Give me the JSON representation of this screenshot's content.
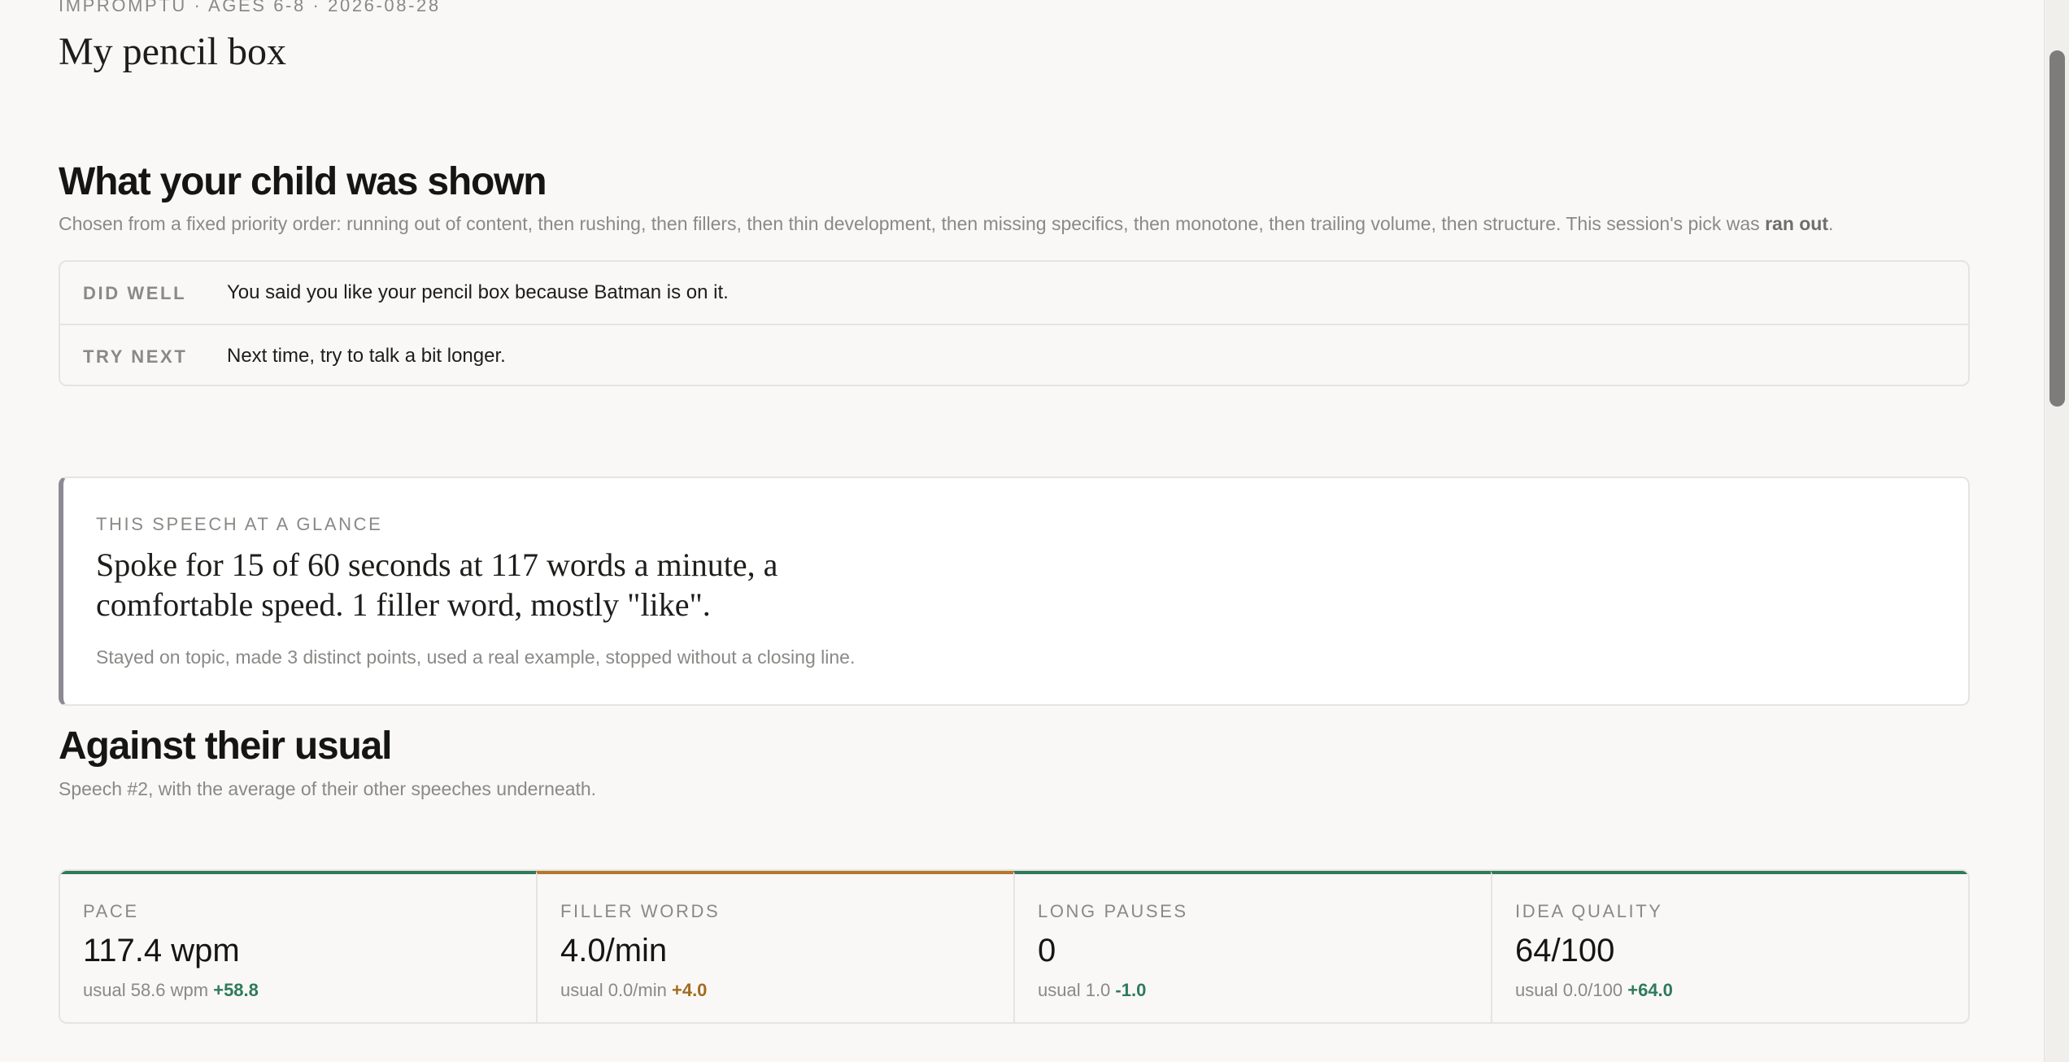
{
  "header": {
    "eyebrow": "IMPROMPTU · AGES 6-8 · 2026-08-28",
    "title": "My pencil box"
  },
  "shown": {
    "heading": "What your child was shown",
    "description": "Chosen from a fixed priority order: running out of content, then rushing, then fillers, then thin development, then missing specifics, then monotone, then trailing volume, then structure. This session's pick was ",
    "pick": "ran out",
    "pick_suffix": ".",
    "rows": [
      {
        "label": "DID WELL",
        "text": "You said you like your pencil box because Batman is on it."
      },
      {
        "label": "TRY NEXT",
        "text": "Next time, try to talk a bit longer."
      }
    ]
  },
  "glance": {
    "label": "THIS SPEECH AT A GLANCE",
    "summary": "Spoke for 15 of 60 seconds at 117 words a minute, a comfortable speed. 1 filler word, mostly \"like\".",
    "detail": "Stayed on topic, made 3 distinct points, used a real example, stopped without a closing line."
  },
  "usual": {
    "heading": "Against their usual",
    "description": "Speech #2, with the average of their other speeches underneath."
  },
  "metrics": [
    {
      "label": "PACE",
      "value": "117.4 wpm",
      "usual": "usual 58.6 wpm",
      "delta": "+58.8",
      "status": "good"
    },
    {
      "label": "FILLER WORDS",
      "value": "4.0/min",
      "usual": "usual 0.0/min",
      "delta": "+4.0",
      "status": "warn"
    },
    {
      "label": "LONG PAUSES",
      "value": "0",
      "usual": "usual 1.0",
      "delta": "-1.0",
      "status": "good"
    },
    {
      "label": "IDEA QUALITY",
      "value": "64/100",
      "usual": "usual 0.0/100",
      "delta": "+64.0",
      "status": "good"
    }
  ],
  "colors": {
    "good": "#2e7a5a",
    "warn": "#b5772a",
    "accent_bar": "#8c8a93"
  }
}
